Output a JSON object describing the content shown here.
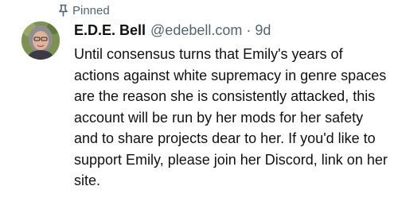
{
  "pinned": {
    "label": "Pinned",
    "icon": "pin-icon"
  },
  "author": {
    "display_name": "E.D.E. Bell",
    "handle": "@edebell.com",
    "avatar": "avatar"
  },
  "meta": {
    "separator": "·",
    "time": "9d"
  },
  "post": {
    "text": "Until consensus turns that Emily's years of actions against white supremacy in genre spaces are the reason she is consistently attacked, this account will be run by her mods for her safety and to share projects dear to her. If you'd like to support Emily, please join her Discord, link on her site."
  },
  "colors": {
    "text": "#111111",
    "muted": "#536471",
    "background": "#ffffff"
  }
}
